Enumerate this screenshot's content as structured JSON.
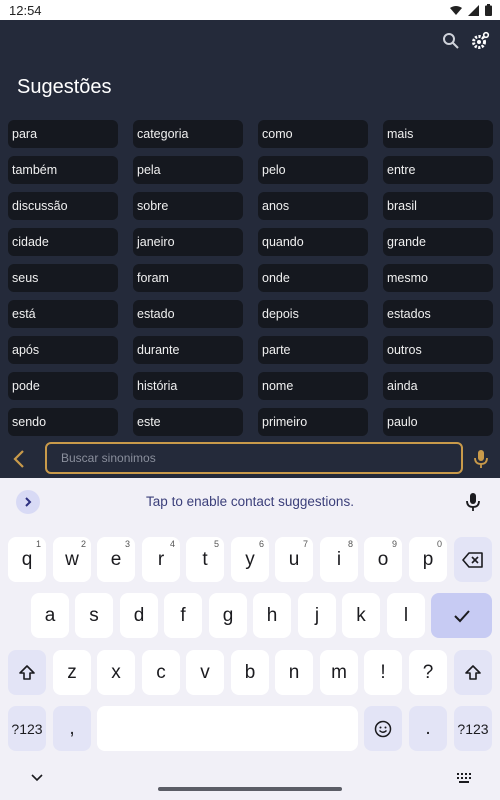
{
  "status_bar": {
    "time": "12:54"
  },
  "app": {
    "title": "Sugestões",
    "suggestions": [
      "para",
      "categoria",
      "como",
      "mais",
      "também",
      "pela",
      "pelo",
      "entre",
      "discussão",
      "sobre",
      "anos",
      "brasil",
      "cidade",
      "janeiro",
      "quando",
      "grande",
      "seus",
      "foram",
      "onde",
      "mesmo",
      "está",
      "estado",
      "depois",
      "estados",
      "após",
      "durante",
      "parte",
      "outros",
      "pode",
      "história",
      "nome",
      "ainda",
      "sendo",
      "este",
      "primeiro",
      "paulo"
    ],
    "search": {
      "placeholder": "Buscar sinonimos"
    }
  },
  "keyboard": {
    "suggestion_text": "Tap to enable contact suggestions.",
    "row1": [
      {
        "key": "q",
        "hint": "1"
      },
      {
        "key": "w",
        "hint": "2"
      },
      {
        "key": "e",
        "hint": "3"
      },
      {
        "key": "r",
        "hint": "4"
      },
      {
        "key": "t",
        "hint": "5"
      },
      {
        "key": "y",
        "hint": "6"
      },
      {
        "key": "u",
        "hint": "7"
      },
      {
        "key": "i",
        "hint": "8"
      },
      {
        "key": "o",
        "hint": "9"
      },
      {
        "key": "p",
        "hint": "0"
      }
    ],
    "row2": [
      "a",
      "s",
      "d",
      "f",
      "g",
      "h",
      "j",
      "k",
      "l"
    ],
    "row3": [
      "z",
      "x",
      "c",
      "v",
      "b",
      "n",
      "m",
      "!",
      "?"
    ],
    "symbols_label": "?123",
    "comma": ",",
    "period": "."
  },
  "colors": {
    "app_background": "#242a3a",
    "chip_background": "#15181f",
    "search_border": "#c99a4a",
    "keyboard_background": "#f1f0f7",
    "enter_key": "#c7cbf3"
  }
}
